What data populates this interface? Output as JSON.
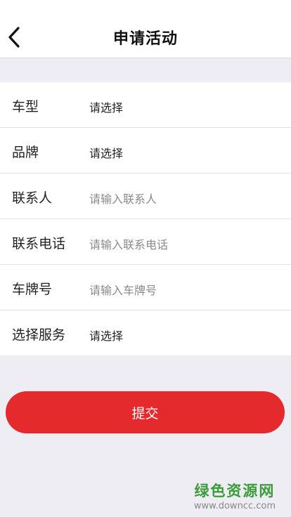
{
  "header": {
    "title": "申请活动",
    "back_icon": "chevron-left-icon"
  },
  "form": {
    "rows": [
      {
        "label": "车型",
        "value": "请选择",
        "is_placeholder": false
      },
      {
        "label": "品牌",
        "value": "请选择",
        "is_placeholder": false
      },
      {
        "label": "联系人",
        "value": "请输入联系人",
        "is_placeholder": true
      },
      {
        "label": "联系电话",
        "value": "请输入联系电话",
        "is_placeholder": true
      },
      {
        "label": "车牌号",
        "value": "请输入车牌号",
        "is_placeholder": true
      },
      {
        "label": "选择服务",
        "value": "请选择",
        "is_placeholder": false
      }
    ]
  },
  "submit": {
    "label": "提交"
  },
  "watermark": {
    "main": "绿色资源网",
    "sub": "www.downcc.com"
  },
  "colors": {
    "accent": "#e42a2c",
    "background": "#efedf4",
    "watermark_green": "#3b9c3a"
  }
}
